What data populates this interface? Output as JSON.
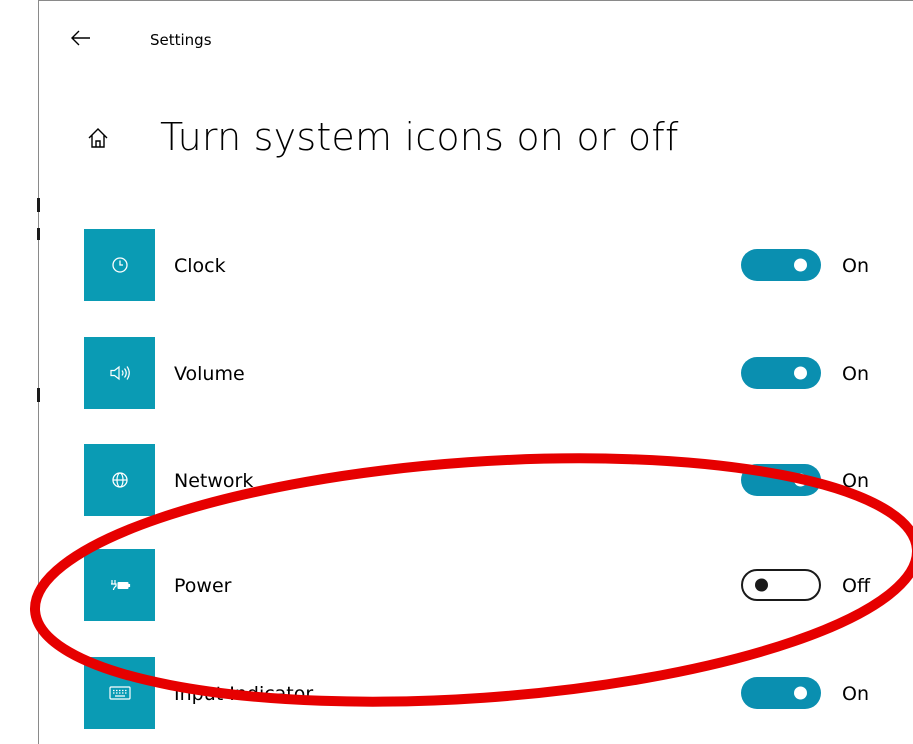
{
  "window": {
    "app_title": "Settings"
  },
  "header": {
    "back_icon": "arrow-left-icon",
    "home_icon": "home-icon",
    "page_title": "Turn system icons on or off"
  },
  "settings": [
    {
      "label": "Clock",
      "icon": "clock-icon",
      "state": "On",
      "checked": true
    },
    {
      "label": "Volume",
      "icon": "volume-icon",
      "state": "On",
      "checked": true
    },
    {
      "label": "Network",
      "icon": "network-globe-icon",
      "state": "On",
      "checked": true
    },
    {
      "label": "Power",
      "icon": "power-battery-icon",
      "state": "Off",
      "checked": false
    },
    {
      "label": "Input Indicator",
      "icon": "keyboard-icon",
      "state": "On",
      "checked": true
    }
  ],
  "annotation": {
    "shape": "ellipse",
    "color": "#e60000",
    "highlights": "Power"
  },
  "colors": {
    "tile_accent": "#0a9bb4",
    "toggle_on": "#0a8fb0",
    "toggle_off_border": "#1a1a1a"
  }
}
